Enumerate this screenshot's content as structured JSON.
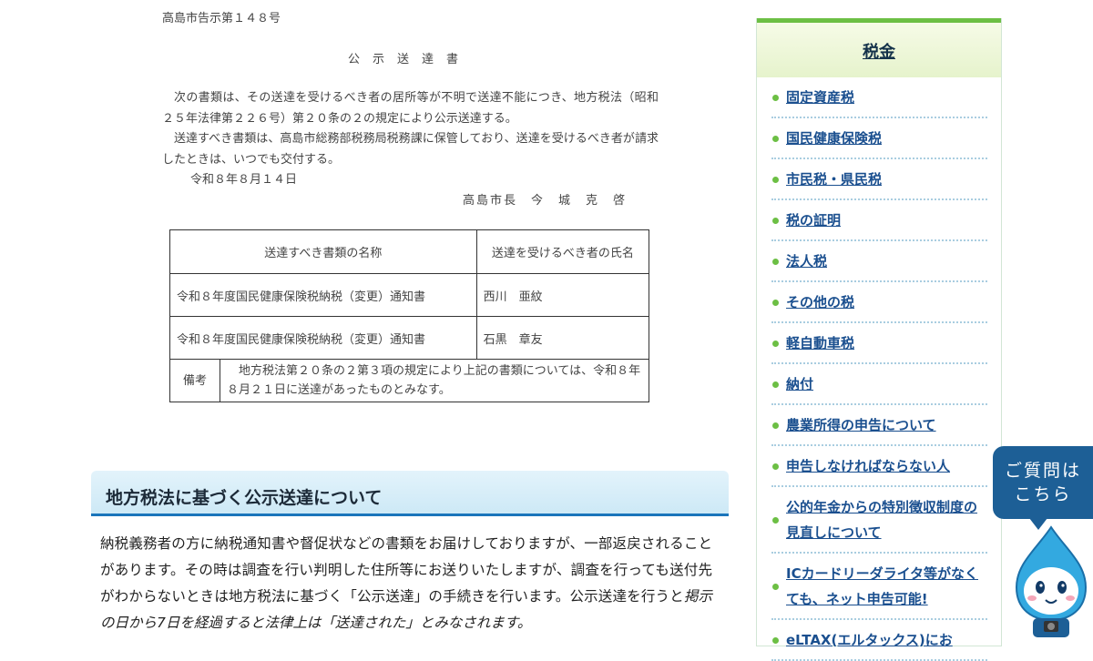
{
  "notice": {
    "number": "高島市告示第１４８号",
    "title": "公示送達書",
    "paragraph1": "次の書類は、その送達を受けるべき者の居所等が不明で送達不能につき、地方税法（昭和２５年法律第２２６号）第２０条の２の規定により公示送達する。",
    "paragraph2": "送達すべき書類は、高島市総務部税務局税務課に保管しており、送達を受けるべき者が請求したときは、いつでも交付する。",
    "date": "令和８年８月１４日",
    "issuer": "高島市長　今　城　克　啓"
  },
  "doc_table": {
    "header_document": "送達すべき書類の名称",
    "header_recipient": "送達を受けるべき者の氏名",
    "rows": [
      {
        "document": "令和８年度国民健康保険税納税（変更）通知書",
        "recipient": "西川　亜紋"
      },
      {
        "document": "令和８年度国民健康保険税納税（変更）通知書",
        "recipient": "石黒　章友"
      }
    ],
    "remark_label": "備考",
    "remark_text": "地方税法第２０条の２第３項の規定により上記の書類については、令和８年８月２１日に送達があったものとみなす。"
  },
  "section": {
    "heading": "地方税法に基づく公示送達について",
    "body_normal": "納税義務者の方に納税通知書や督促状などの書類をお届けしておりますが、一部返戻されることがあります。その時は調査を行い判明した住所等にお送りいたしますが、調査を行っても送付先がわからないときは地方税法に基づく「公示送達」の手続きを行います。公示送達を行うと",
    "body_italic": "掲示の日から7日を経過すると法律上は「送達された」とみなされます。"
  },
  "sidebar": {
    "title": "税金",
    "items": [
      "固定資産税",
      "国民健康保険税",
      "市民税・県民税",
      "税の証明",
      "法人税",
      "その他の税",
      "軽自動車税",
      "納付",
      "農業所得の申告について",
      "申告しなければならない人",
      "公的年金からの特別徴収制度の見直しについて",
      "ICカードリーダライタ等がなくても、ネット申告可能!",
      "eLTAX(エルタックス)にお"
    ]
  },
  "help": {
    "label": "ご質問はこちら",
    "line1": "ご質問は",
    "line2": "こちら"
  },
  "colors": {
    "accent_blue": "#1a75bb",
    "link_blue": "#1a4f8f",
    "sidebar_green": "#6cbf44",
    "help_bg": "#1d5f96"
  },
  "icons": {
    "mascot": "water-drop-mascot-icon",
    "bullet": "green-dot-bullet-icon"
  }
}
